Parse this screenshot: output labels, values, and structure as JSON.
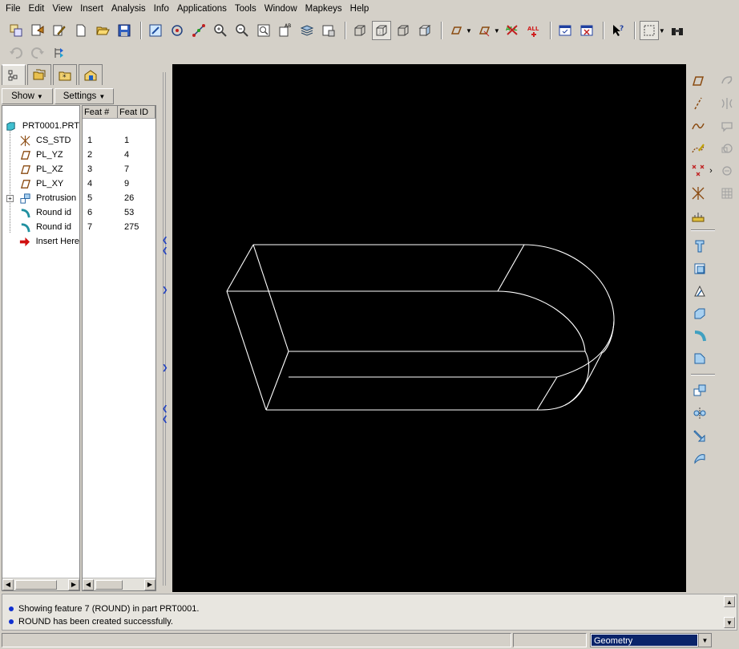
{
  "menubar": {
    "items": [
      {
        "label": "File"
      },
      {
        "label": "Edit"
      },
      {
        "label": "View"
      },
      {
        "label": "Insert"
      },
      {
        "label": "Analysis"
      },
      {
        "label": "Info"
      },
      {
        "label": "Applications"
      },
      {
        "label": "Tools"
      },
      {
        "label": "Window"
      },
      {
        "label": "Mapkeys"
      },
      {
        "label": "Help"
      }
    ]
  },
  "navigator": {
    "show_label": "Show",
    "settings_label": "Settings",
    "columns": {
      "feat_num": "Feat #",
      "feat_id": "Feat ID"
    },
    "items": [
      {
        "label": "PRT0001.PRT",
        "icon": "part-icon",
        "num": "",
        "id": ""
      },
      {
        "label": "CS_STD",
        "icon": "coordinate-system-icon",
        "num": "1",
        "id": "1"
      },
      {
        "label": "PL_YZ",
        "icon": "datum-plane-icon",
        "num": "2",
        "id": "4"
      },
      {
        "label": "PL_XZ",
        "icon": "datum-plane-icon",
        "num": "3",
        "id": "7"
      },
      {
        "label": "PL_XY",
        "icon": "datum-plane-icon",
        "num": "4",
        "id": "9"
      },
      {
        "label": "Protrusion",
        "icon": "protrusion-icon",
        "num": "5",
        "id": "26"
      },
      {
        "label": "Round id",
        "icon": "round-icon",
        "num": "6",
        "id": "53"
      },
      {
        "label": "Round id",
        "icon": "round-icon",
        "num": "7",
        "id": "275"
      },
      {
        "label": "Insert Here",
        "icon": "insert-here-arrow-icon",
        "num": "",
        "id": ""
      }
    ]
  },
  "messages": [
    {
      "text": "Showing feature 7 (ROUND) in part PRT0001."
    },
    {
      "text": "ROUND has been created successfully."
    }
  ],
  "status": {
    "filter_value": "Geometry"
  },
  "colors": {
    "accent": "#0a246a",
    "viewport_bg": "#000000",
    "geometry_line": "#ffffff"
  }
}
